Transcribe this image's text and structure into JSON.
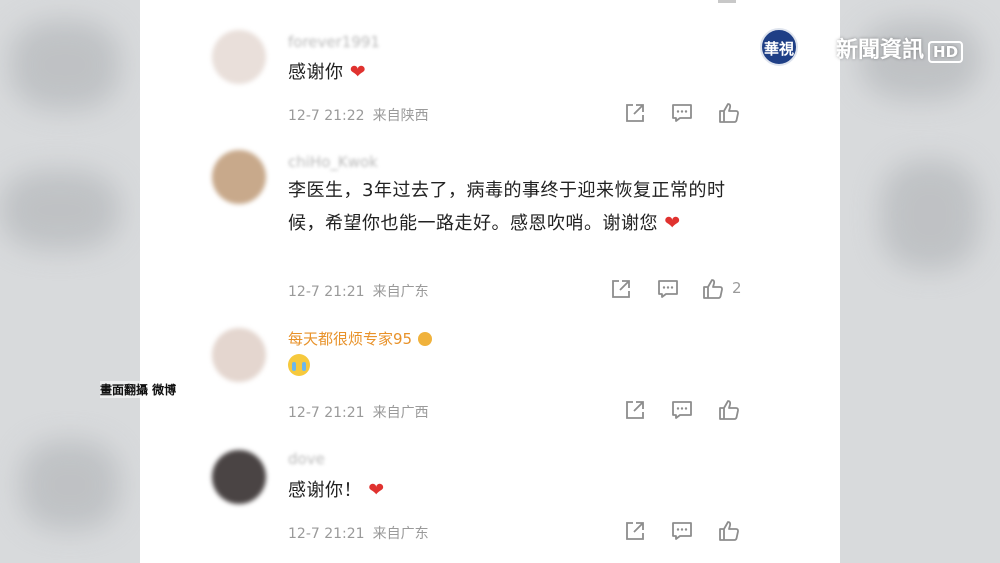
{
  "channel": {
    "logo_text": "華視",
    "name": "新聞資訊",
    "hd": "HD"
  },
  "credit": "畫面翻攝 微博",
  "comments": [
    {
      "username": "forever1991",
      "text": "感谢你",
      "emoji": "red-heart",
      "date": "12-7 21:22",
      "location": "来自陕西",
      "likes": ""
    },
    {
      "username": "chiHo_Kwok",
      "text": "李医生，3年过去了，病毒的事终于迎来恢复正常的时候，希望你也能一路走好。感恩吹哨。谢谢您",
      "emoji": "red-heart",
      "date": "12-7 21:21",
      "location": "来自广东",
      "likes": "2"
    },
    {
      "username": "每天都很烦专家95",
      "text": "",
      "emoji": "crying-face",
      "date": "12-7 21:21",
      "location": "来自广西",
      "likes": ""
    },
    {
      "username": "dove",
      "text": "感谢你！",
      "emoji": "red-heart",
      "date": "12-7 21:21",
      "location": "来自广东",
      "likes": ""
    }
  ],
  "colors": {
    "heart": "#e0322f",
    "username_orange": "#e8922a",
    "meta_gray": "#9a9a9a",
    "text": "#222222"
  }
}
